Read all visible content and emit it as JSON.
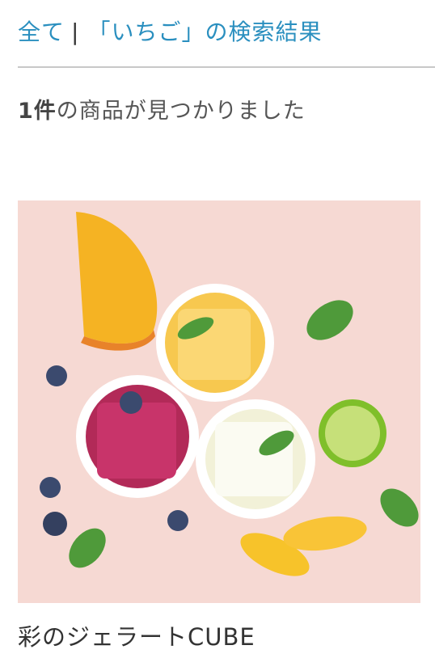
{
  "breadcrumb": {
    "all_label": "全て",
    "separator": "|",
    "current_label": "「いちご」の検索結果"
  },
  "results": {
    "count": "1件",
    "count_suffix": "の商品が見つかりました"
  },
  "products": [
    {
      "name": "彩のジェラートCUBE",
      "image_icon": "gelato-photo-icon"
    }
  ],
  "colors": {
    "link": "#2a8fbf",
    "text": "#333333",
    "image_background": "#f6d9d3"
  }
}
